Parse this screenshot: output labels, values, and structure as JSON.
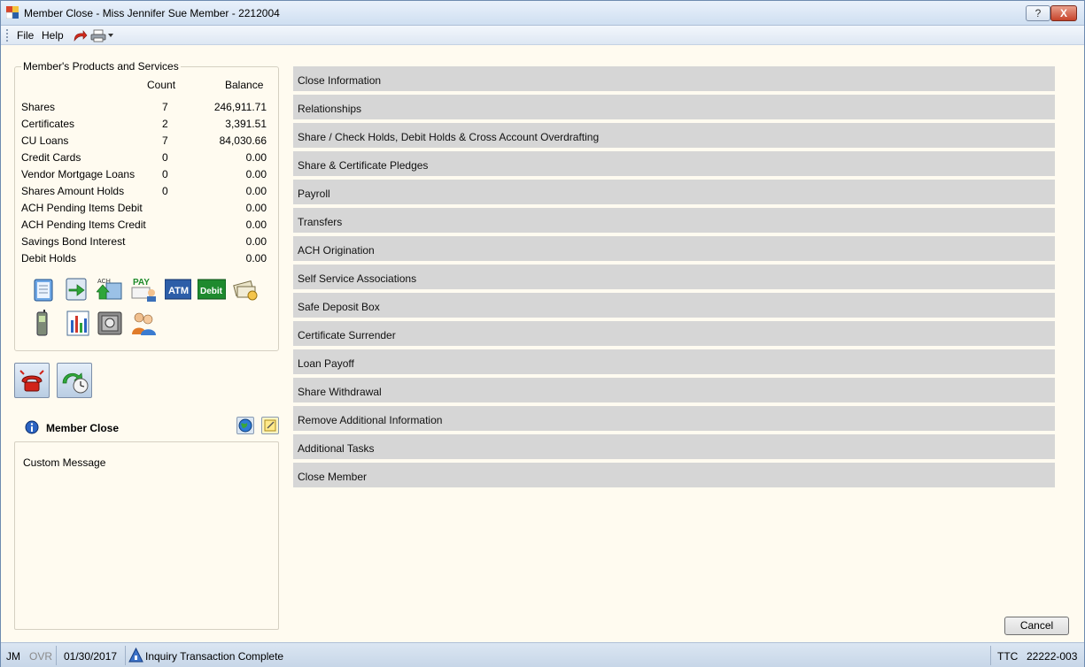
{
  "window": {
    "title": "Member Close - Miss Jennifer Sue Member - 2212004",
    "help_button": "?",
    "close_button": "X"
  },
  "menu": {
    "file": "File",
    "help": "Help",
    "icons": [
      "redo-icon",
      "printer-icon"
    ]
  },
  "products": {
    "title": "Member's Products and Services",
    "col_count": "Count",
    "col_balance": "Balance",
    "rows": [
      {
        "name": "Shares",
        "count": "7",
        "balance": "246,911.71"
      },
      {
        "name": "Certificates",
        "count": "2",
        "balance": "3,391.51"
      },
      {
        "name": "CU Loans",
        "count": "7",
        "balance": "84,030.66"
      },
      {
        "name": "Credit Cards",
        "count": "0",
        "balance": "0.00"
      },
      {
        "name": "Vendor Mortgage Loans",
        "count": "0",
        "balance": "0.00"
      },
      {
        "name": "Shares Amount Holds",
        "count": "0",
        "balance": "0.00"
      },
      {
        "name": "ACH Pending Items Debit",
        "count": "",
        "balance": "0.00"
      },
      {
        "name": "ACH Pending Items Credit",
        "count": "",
        "balance": "0.00"
      },
      {
        "name": "Savings Bond Interest",
        "count": "",
        "balance": "0.00"
      },
      {
        "name": "Debit Holds",
        "count": "",
        "balance": "0.00"
      }
    ],
    "icon_labels": {
      "ach": "ACH",
      "pay": "PAY",
      "atm": "ATM",
      "debit": "Debit"
    }
  },
  "member_close": {
    "title": "Member Close",
    "message": "Custom Message"
  },
  "tasks": [
    "Close Information",
    "Relationships",
    "Share / Check Holds, Debit Holds & Cross Account Overdrafting",
    "Share & Certificate Pledges",
    "Payroll",
    "Transfers",
    "ACH Origination",
    "Self Service Associations",
    "Safe Deposit Box",
    "Certificate Surrender",
    "Loan Payoff",
    "Share Withdrawal",
    "Remove Additional Information",
    "Additional Tasks",
    "Close Member"
  ],
  "buttons": {
    "cancel": "Cancel"
  },
  "status": {
    "user": "JM",
    "mode": "OVR",
    "date": "01/30/2017",
    "message": "Inquiry Transaction Complete",
    "ttc_label": "TTC",
    "ttc_code": "22222-003"
  }
}
